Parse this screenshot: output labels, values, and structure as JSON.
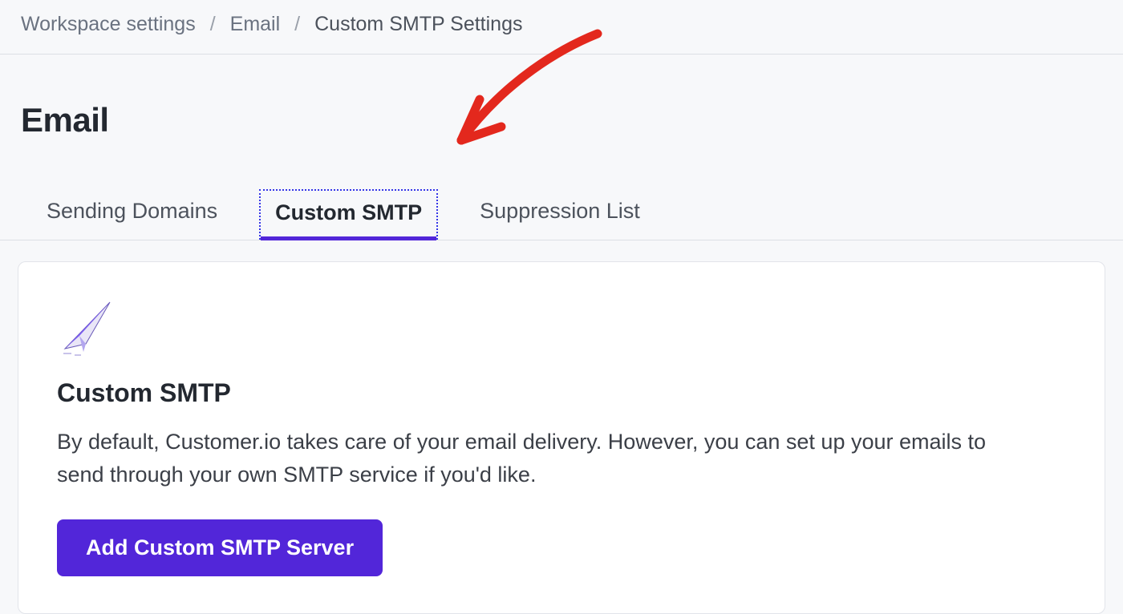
{
  "breadcrumb": {
    "items": [
      {
        "label": "Workspace settings"
      },
      {
        "label": "Email"
      },
      {
        "label": "Custom SMTP Settings"
      }
    ],
    "separator": "/"
  },
  "page": {
    "title": "Email"
  },
  "tabs": [
    {
      "label": "Sending Domains",
      "active": false
    },
    {
      "label": "Custom SMTP",
      "active": true
    },
    {
      "label": "Suppression List",
      "active": false
    }
  ],
  "card": {
    "icon_name": "paper-plane-icon",
    "title": "Custom SMTP",
    "description": "By default, Customer.io takes care of your email delivery. However, you can set up your emails to send through your own SMTP service if you'd like.",
    "primary_button_label": "Add Custom SMTP Server"
  },
  "colors": {
    "accent": "#5226d9",
    "annotation": "#e3281d"
  }
}
